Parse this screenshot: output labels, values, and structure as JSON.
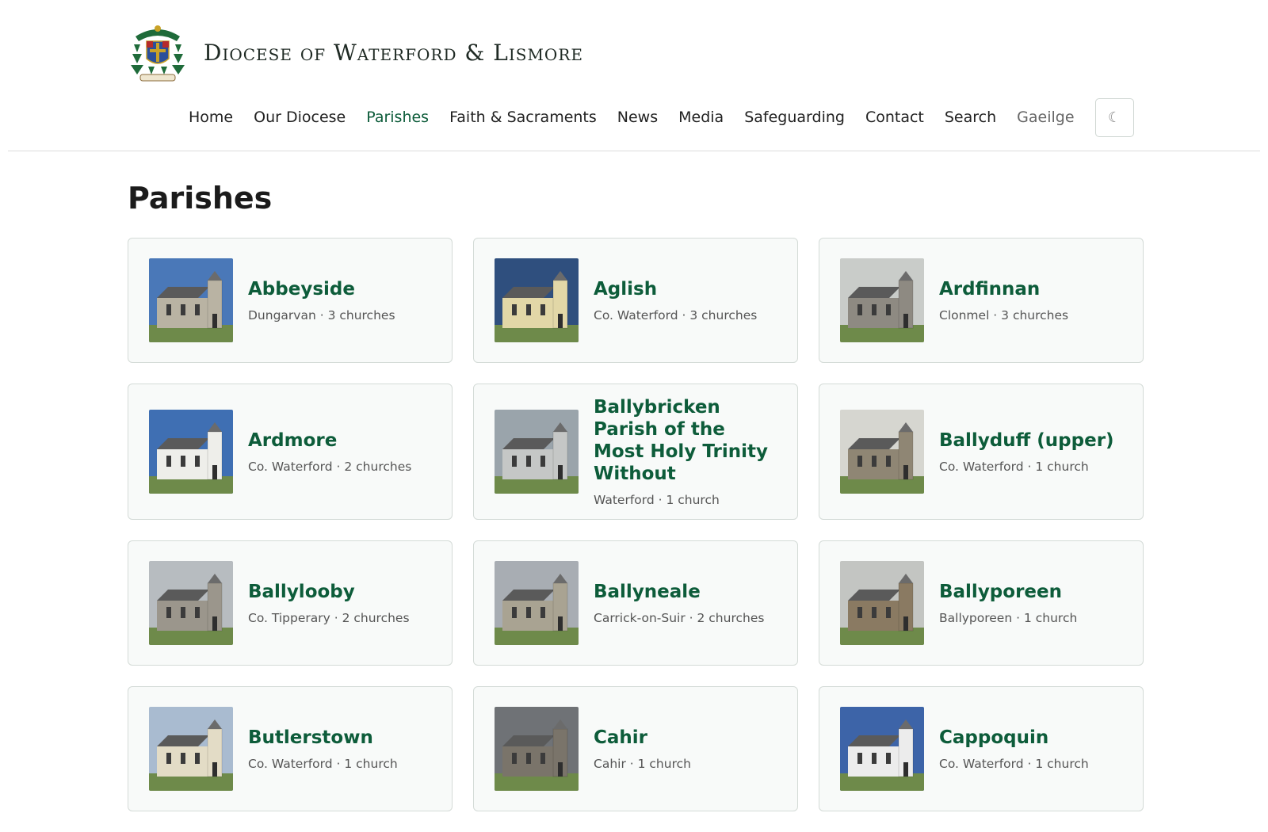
{
  "site": {
    "title": "Diocese of Waterford & Lismore"
  },
  "nav": {
    "items": [
      {
        "label": "Home"
      },
      {
        "label": "Our Diocese"
      },
      {
        "label": "Parishes"
      },
      {
        "label": "Faith & Sacraments"
      },
      {
        "label": "News"
      },
      {
        "label": "Media"
      },
      {
        "label": "Safeguarding"
      },
      {
        "label": "Contact"
      },
      {
        "label": "Search"
      },
      {
        "label": "Gaeilge"
      }
    ],
    "active": "Parishes",
    "theme_toggle_icon": "☾"
  },
  "page": {
    "title": "Parishes"
  },
  "parishes": [
    {
      "name": "Abbeyside",
      "meta": "Dungarvan · 3 churches",
      "sky": "#4a78b8",
      "wall": "#b9b3a3"
    },
    {
      "name": "Aglish",
      "meta": "Co. Waterford · 3 churches",
      "sky": "#2f4f7e",
      "wall": "#e2d7a7"
    },
    {
      "name": "Ardfinnan",
      "meta": "Clonmel · 3 churches",
      "sky": "#c9ccc9",
      "wall": "#8e8a82"
    },
    {
      "name": "Ardmore",
      "meta": "Co. Waterford · 2 churches",
      "sky": "#3f6fb3",
      "wall": "#eeeeea"
    },
    {
      "name": "Ballybricken Parish of the Most Holy Trinity Without",
      "meta": "Waterford · 1 church",
      "sky": "#9aa4ab",
      "wall": "#c5c7c6"
    },
    {
      "name": "Ballyduff (upper)",
      "meta": "Co. Waterford · 1 church",
      "sky": "#d6d6d0",
      "wall": "#8f8674"
    },
    {
      "name": "Ballylooby",
      "meta": "Co. Tipperary · 2 churches",
      "sky": "#b7bcc0",
      "wall": "#9b968c"
    },
    {
      "name": "Ballyneale",
      "meta": "Carrick-on-Suir · 2 churches",
      "sky": "#a8adb3",
      "wall": "#a9a392"
    },
    {
      "name": "Ballyporeen",
      "meta": "Ballyporeen · 1 church",
      "sky": "#c3c5c2",
      "wall": "#8a7a62"
    },
    {
      "name": "Butlerstown",
      "meta": "Co. Waterford · 1 church",
      "sky": "#a9bbd0",
      "wall": "#e3dcc6"
    },
    {
      "name": "Cahir",
      "meta": "Cahir · 1 church",
      "sky": "#6f7276",
      "wall": "#7a746a"
    },
    {
      "name": "Cappoquin",
      "meta": "Co. Waterford · 1 church",
      "sky": "#3d64a8",
      "wall": "#ececec"
    }
  ]
}
